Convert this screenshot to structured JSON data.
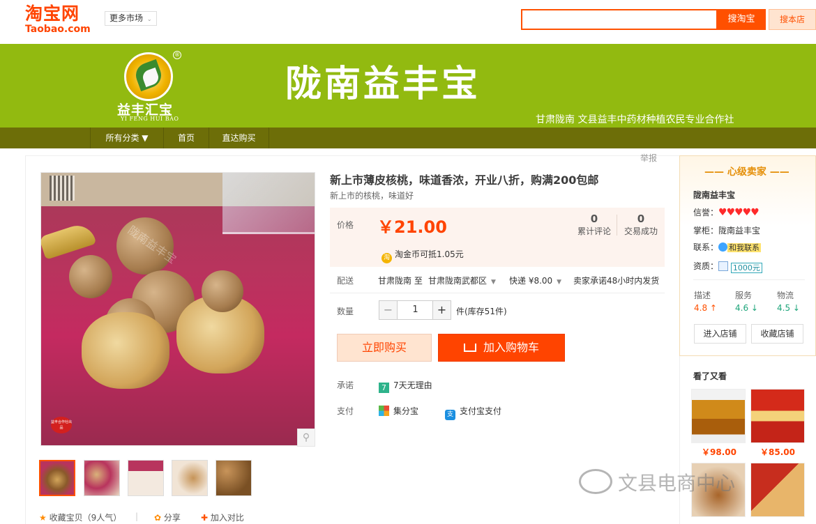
{
  "taobao": {
    "logo_main": "淘宝网",
    "logo_sub": "Taobao.com",
    "more_markets": "更多市场",
    "search_button": "搜淘宝",
    "search_shop_button": "搜本店"
  },
  "shop": {
    "logo_cn": "益丰汇宝",
    "logo_en": "YI FENG HUI BAO",
    "registered_mark": "®",
    "title": "陇南益丰宝",
    "subtitle": "甘肃陇南 文县益丰中药材种植农民专业合作社"
  },
  "nav": {
    "items": [
      {
        "label": "所有分类 ▼"
      },
      {
        "label": "首页"
      },
      {
        "label": "直达购买"
      }
    ]
  },
  "product": {
    "report": "举报",
    "title": "新上市薄皮核桃，味道香浓，开业八折，购满200包邮",
    "subtitle": "新上市的核桃，味道好",
    "price_label": "价格",
    "price": "￥21.00",
    "reviews_count": "0",
    "reviews_label": "累计评论",
    "deals_count": "0",
    "deals_label": "交易成功",
    "coin_text": "淘金币可抵1.05元",
    "coin_icon_text": "淘",
    "ship_label": "配送",
    "ship_from": "甘肃陇南 至",
    "ship_to": "甘肃陇南武都区",
    "ship_fee": "快递 ¥8.00",
    "ship_promise": "卖家承诺48小时内发货",
    "qty_label": "数量",
    "qty_value": "1",
    "qty_minus": "−",
    "qty_plus": "+",
    "stock": "件(库存51件)",
    "buy_now": "立即购买",
    "add_to_cart": "加入购物车",
    "promise_label": "承诺",
    "promise_text": "7天无理由",
    "promise_icon": "7",
    "pay_label": "支付",
    "pay_option1": "集分宝",
    "pay_option2": "支付宝支付",
    "pay_icon2": "支",
    "image_watermark": "陇南益丰宝",
    "stamp_text": "益丰合作社出品"
  },
  "actions": {
    "favorite": "收藏宝贝（9人气）",
    "share": "分享",
    "compare": "加入对比"
  },
  "seller": {
    "heading": "—— 心级卖家 ——",
    "name": "陇南益丰宝",
    "credit_label": "信誉：",
    "hearts": "♥♥♥♥♥",
    "keeper_label": "掌柜：",
    "keeper": "陇南益丰宝",
    "contact_label": "联系：",
    "contact": "和我联系",
    "quali_label": "资质：",
    "deposit": "1000元",
    "desc_label": "描述",
    "desc_value": "4.8 ↑",
    "service_label": "服务",
    "service_value": "4.6 ↓",
    "logistics_label": "物流",
    "logistics_value": "4.5 ↓",
    "enter_shop": "进入店铺",
    "fav_shop": "收藏店铺"
  },
  "see_also": {
    "title": "看了又看",
    "items": [
      {
        "price": "￥98.00"
      },
      {
        "price": "￥85.00"
      }
    ]
  },
  "watermark": {
    "text": "文县电商中心"
  }
}
